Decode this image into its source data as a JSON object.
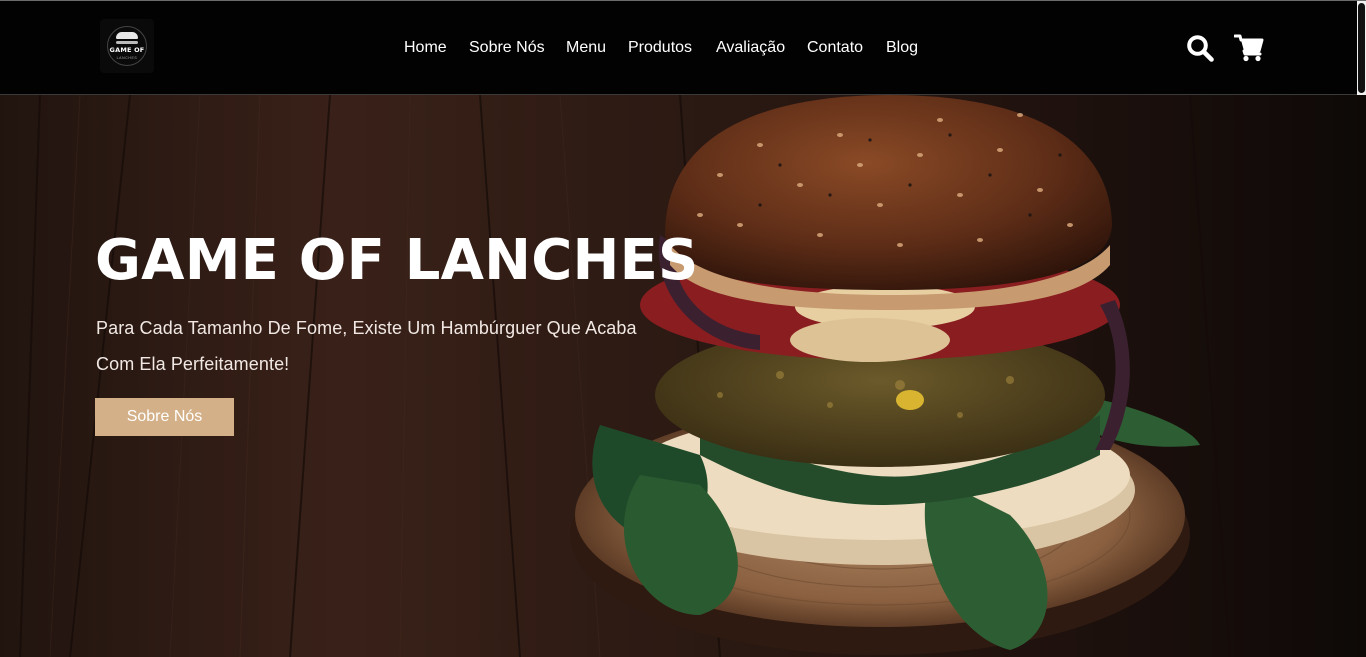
{
  "brand": {
    "logo_icon": "burger-logo-icon",
    "logo_text": "GAME OF",
    "logo_subtext": "LANCHES"
  },
  "nav": {
    "items": [
      "Home",
      "Sobre Nós",
      "Menu",
      "Produtos",
      "Avaliação",
      "Contato",
      "Blog"
    ]
  },
  "header_icons": {
    "search": "search-icon",
    "cart": "shopping-cart-icon"
  },
  "hero": {
    "title": "GAME OF LANCHES",
    "subtitle": "Para Cada Tamanho De Fome, Existe Um Hambúrguer Que Acaba Com Ela Perfeitamente!",
    "button_label": "Sobre Nós",
    "image": "burger-photo"
  },
  "colors": {
    "navbar_bg": "#020203",
    "button_bg": "#d3b088",
    "text": "#ffffff"
  }
}
